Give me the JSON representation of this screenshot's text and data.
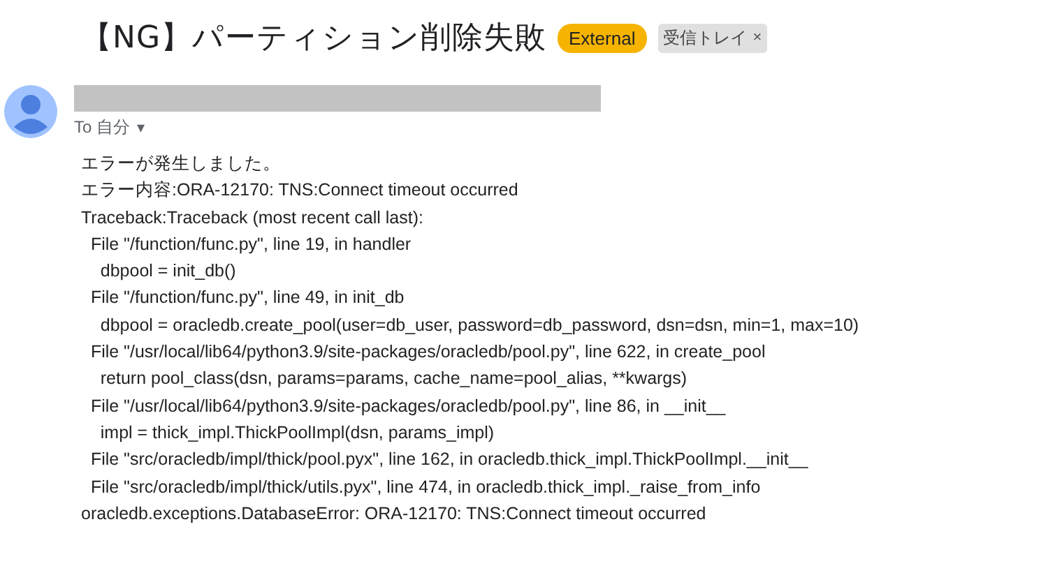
{
  "subject": {
    "title": "【NG】パーティション削除失敗",
    "labels": [
      {
        "kind": "badge",
        "text": "External"
      },
      {
        "kind": "chip",
        "text": "受信トレイ",
        "close": "×"
      }
    ]
  },
  "sender": {
    "recipient": "To 自分",
    "caret": "▾"
  },
  "body": {
    "lines": [
      "エラーが発生しました。",
      "エラー内容:ORA-12170: TNS:Connect timeout occurred",
      "Traceback:Traceback (most recent call last):",
      "  File \"/function/func.py\", line 19, in handler",
      "    dbpool = init_db()",
      "  File \"/function/func.py\", line 49, in init_db",
      "    dbpool = oracledb.create_pool(user=db_user, password=db_password, dsn=dsn, min=1, max=10)",
      "  File \"/usr/local/lib64/python3.9/site-packages/oracledb/pool.py\", line 622, in create_pool",
      "    return pool_class(dsn, params=params, cache_name=pool_alias, **kwargs)",
      "  File \"/usr/local/lib64/python3.9/site-packages/oracledb/pool.py\", line 86, in __init__",
      "    impl = thick_impl.ThickPoolImpl(dsn, params_impl)",
      "  File \"src/oracledb/impl/thick/pool.pyx\", line 162, in oracledb.thick_impl.ThickPoolImpl.__init__",
      "  File \"src/oracledb/impl/thick/utils.pyx\", line 474, in oracledb.thick_impl._raise_from_info",
      "oracledb.exceptions.DatabaseError: ORA-12170: TNS:Connect timeout occurred"
    ]
  }
}
